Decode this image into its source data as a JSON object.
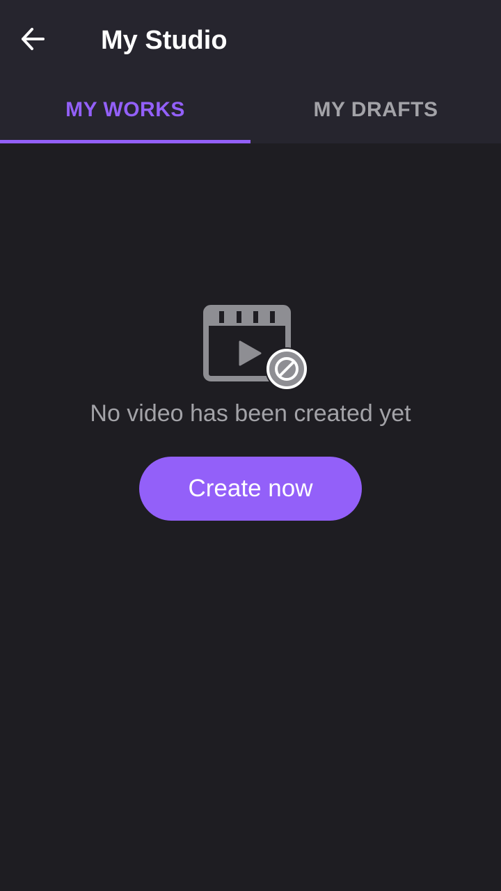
{
  "header": {
    "title": "My Studio",
    "back_icon": "arrow-left-icon"
  },
  "tabs": [
    {
      "label": "MY WORKS",
      "active": true
    },
    {
      "label": "MY DRAFTS",
      "active": false
    }
  ],
  "empty_state": {
    "icon": "video-clapperboard-prohibited-icon",
    "message": "No video has been created yet",
    "button_label": "Create now"
  },
  "colors": {
    "accent": "#9360f9",
    "background": "#1e1d22",
    "header_background": "#26252e",
    "muted_text": "#a3a3a8",
    "icon_gray": "#8e8e93"
  }
}
